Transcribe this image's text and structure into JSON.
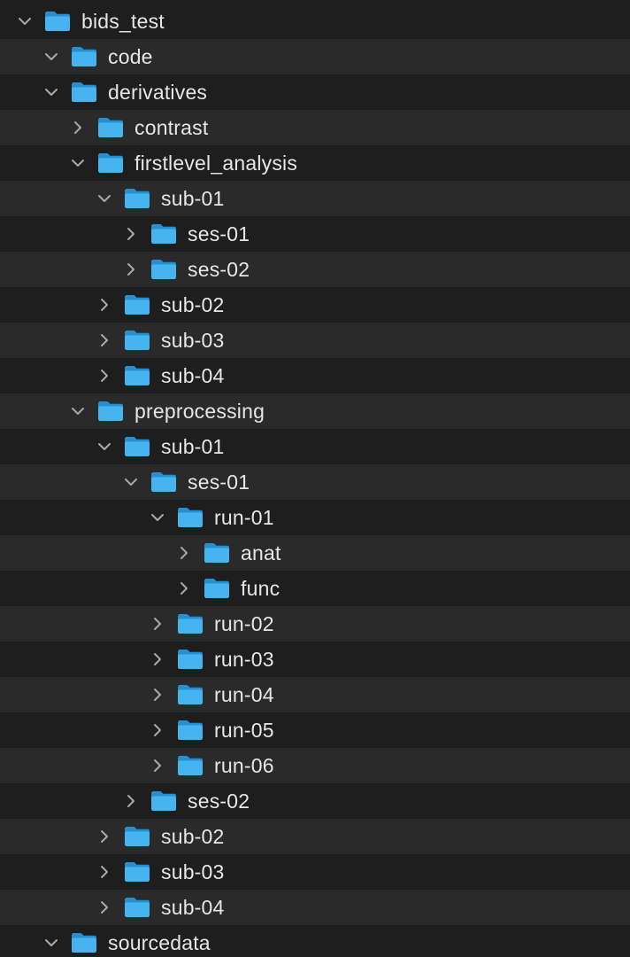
{
  "colors": {
    "background": "#1e1e1e",
    "row_alt": "#2a2a2a",
    "text": "#e6e6e6",
    "chevron": "#a8a8a8",
    "folder_front": "#45b4f0",
    "folder_back": "#2a8fd0"
  },
  "rows": [
    {
      "label": "bids_test",
      "level": 0,
      "state": "expanded",
      "icon": "folder-icon"
    },
    {
      "label": "code",
      "level": 1,
      "state": "expanded",
      "icon": "folder-icon"
    },
    {
      "label": "derivatives",
      "level": 1,
      "state": "expanded",
      "icon": "folder-icon"
    },
    {
      "label": "contrast",
      "level": 2,
      "state": "collapsed",
      "icon": "folder-icon"
    },
    {
      "label": "firstlevel_analysis",
      "level": 2,
      "state": "expanded",
      "icon": "folder-icon"
    },
    {
      "label": "sub-01",
      "level": 3,
      "state": "expanded",
      "icon": "folder-icon"
    },
    {
      "label": "ses-01",
      "level": 4,
      "state": "collapsed",
      "icon": "folder-icon"
    },
    {
      "label": "ses-02",
      "level": 4,
      "state": "collapsed",
      "icon": "folder-icon"
    },
    {
      "label": "sub-02",
      "level": 3,
      "state": "collapsed",
      "icon": "folder-icon"
    },
    {
      "label": "sub-03",
      "level": 3,
      "state": "collapsed",
      "icon": "folder-icon"
    },
    {
      "label": "sub-04",
      "level": 3,
      "state": "collapsed",
      "icon": "folder-icon"
    },
    {
      "label": "preprocessing",
      "level": 2,
      "state": "expanded",
      "icon": "folder-icon"
    },
    {
      "label": "sub-01",
      "level": 3,
      "state": "expanded",
      "icon": "folder-icon"
    },
    {
      "label": "ses-01",
      "level": 4,
      "state": "expanded",
      "icon": "folder-icon"
    },
    {
      "label": "run-01",
      "level": 5,
      "state": "expanded",
      "icon": "folder-icon"
    },
    {
      "label": "anat",
      "level": 6,
      "state": "collapsed",
      "icon": "folder-icon"
    },
    {
      "label": "func",
      "level": 6,
      "state": "collapsed",
      "icon": "folder-icon"
    },
    {
      "label": "run-02",
      "level": 5,
      "state": "collapsed",
      "icon": "folder-icon"
    },
    {
      "label": "run-03",
      "level": 5,
      "state": "collapsed",
      "icon": "folder-icon"
    },
    {
      "label": "run-04",
      "level": 5,
      "state": "collapsed",
      "icon": "folder-icon"
    },
    {
      "label": "run-05",
      "level": 5,
      "state": "collapsed",
      "icon": "folder-icon"
    },
    {
      "label": "run-06",
      "level": 5,
      "state": "collapsed",
      "icon": "folder-icon"
    },
    {
      "label": "ses-02",
      "level": 4,
      "state": "collapsed",
      "icon": "folder-icon"
    },
    {
      "label": "sub-02",
      "level": 3,
      "state": "collapsed",
      "icon": "folder-icon"
    },
    {
      "label": "sub-03",
      "level": 3,
      "state": "collapsed",
      "icon": "folder-icon"
    },
    {
      "label": "sub-04",
      "level": 3,
      "state": "collapsed",
      "icon": "folder-icon"
    },
    {
      "label": "sourcedata",
      "level": 1,
      "state": "expanded",
      "icon": "folder-icon"
    }
  ]
}
